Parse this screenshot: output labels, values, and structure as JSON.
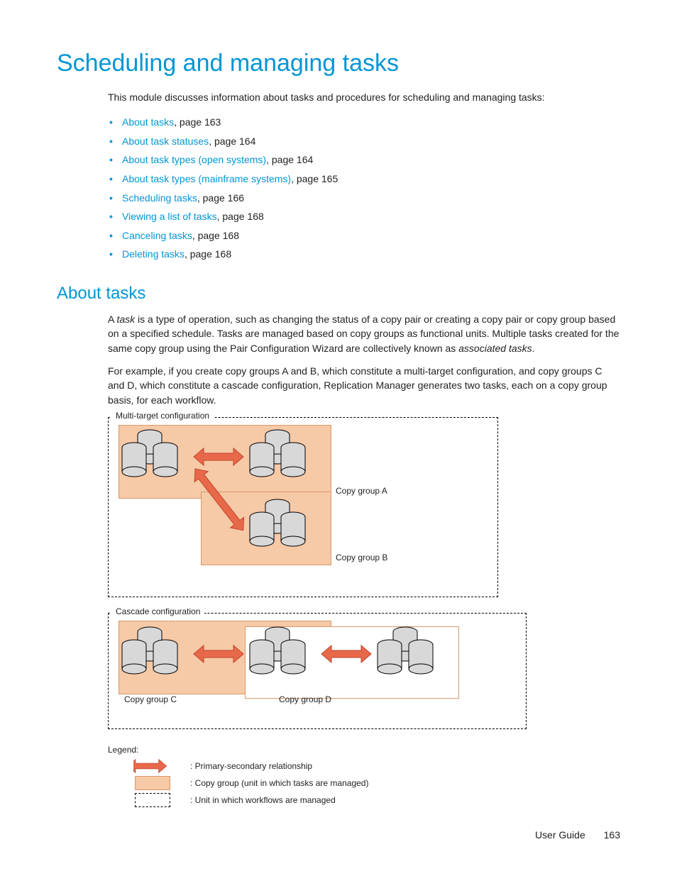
{
  "heading1": "Scheduling and managing tasks",
  "intro": "This module discusses information about tasks and procedures for scheduling and managing tasks:",
  "toc": [
    {
      "link": "About tasks",
      "suffix": ", page 163"
    },
    {
      "link": "About task statuses",
      "suffix": ", page 164"
    },
    {
      "link": "About task types (open systems)",
      "suffix": ", page 164"
    },
    {
      "link": "About task types (mainframe systems)",
      "suffix": ", page 165"
    },
    {
      "link": "Scheduling tasks",
      "suffix": ", page 166"
    },
    {
      "link": "Viewing a list of tasks",
      "suffix": ", page 168"
    },
    {
      "link": "Canceling tasks",
      "suffix": ", page 168"
    },
    {
      "link": "Deleting tasks",
      "suffix": ", page 168"
    }
  ],
  "heading2": "About tasks",
  "para1_pre": "A ",
  "para1_em": "task",
  "para1_mid": " is a type of operation, such as changing the status of a copy pair or creating a copy pair or copy group based on a specified schedule. Tasks are managed based on copy groups as functional units. Multiple tasks created for the same copy group using the Pair Configuration Wizard are collectively known as ",
  "para1_em2": "associated tasks",
  "para1_post": ".",
  "para2": "For example, if you create copy groups A and B, which constitute a multi-target configuration, and copy groups C and D, which constitute a cascade configuration, Replication Manager generates two tasks, each on a copy group basis, for each workflow.",
  "diagram": {
    "multi_label": "Multi-target configuration",
    "cascade_label": "Cascade configuration",
    "group_a": "Copy group A",
    "group_b": "Copy group B",
    "group_c": "Copy group C",
    "group_d": "Copy group D",
    "legend_title": "Legend:",
    "legend_primary": ": Primary-secondary relationship",
    "legend_copygroup": ": Copy group (unit in which tasks are managed)",
    "legend_workflow": ": Unit in which workflows are managed"
  },
  "footer_label": "User Guide",
  "footer_page": "163"
}
